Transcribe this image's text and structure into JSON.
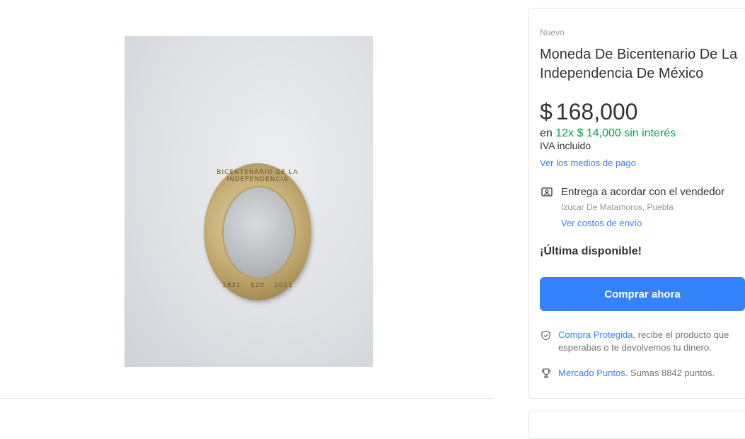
{
  "gallery": {
    "coin_text_top": "BICENTENARIO DE LA INDEPENDENCIA",
    "coin_year_left": "1821",
    "coin_value": "$20",
    "coin_year_right": "2021"
  },
  "product": {
    "condition": "Nuevo",
    "title": "Moneda De Bicentenario De La Independencia De México",
    "price_currency": "$",
    "price_amount": "168,000",
    "installments_prefix": "en",
    "installments_highlight": "12x $ 14,000 sin interés",
    "tax_note": "IVA incluido",
    "payment_methods_link": "Ver los medios de pago"
  },
  "shipping": {
    "icon": "handshake-icon",
    "title": "Entrega a acordar con el vendedor",
    "location": "Izucar De Matamoros, Puebla",
    "costs_link": "Ver costos de envío"
  },
  "stock": {
    "label": "¡Última disponible!"
  },
  "actions": {
    "buy_now": "Comprar ahora"
  },
  "protection": {
    "icon": "shield-check-icon",
    "link": "Compra Protegida",
    "text": ", recibe el producto que esperabas o te devolvemos tu dinero."
  },
  "points": {
    "icon": "trophy-icon",
    "link": "Mercado Puntos.",
    "text": " Sumas 8842 puntos."
  },
  "colors": {
    "accent": "#3483fa",
    "green": "#00a650",
    "text": "#333333",
    "muted": "#999999"
  }
}
